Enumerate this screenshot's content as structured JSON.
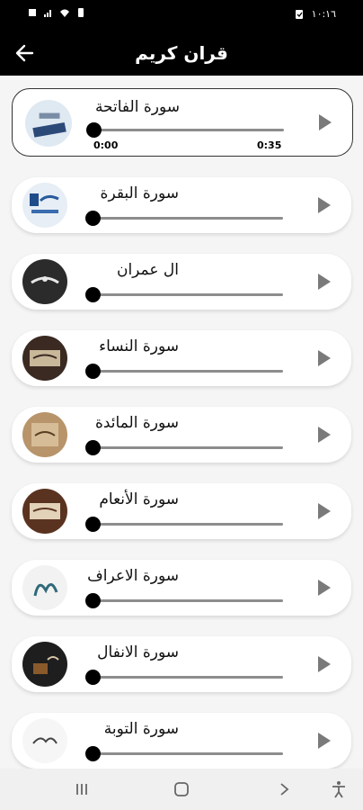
{
  "status_bar": {
    "time": "١٠:١٦"
  },
  "app_bar": {
    "title": "قران كريم"
  },
  "player": {
    "current_time": "0:00",
    "total_time": "0:35"
  },
  "surahs": [
    {
      "name": "سورة الفاتحة",
      "active": true,
      "progress": 0
    },
    {
      "name": "سورة البقرة",
      "progress": 0
    },
    {
      "name": "ال عمران",
      "progress": 0
    },
    {
      "name": "سورة النساء",
      "progress": 0
    },
    {
      "name": "سورة المائدة",
      "progress": 0
    },
    {
      "name": "سورة الأنعام",
      "progress": 0
    },
    {
      "name": "سورة الاعراف",
      "progress": 0
    },
    {
      "name": "سورة الانفال",
      "progress": 0
    },
    {
      "name": "سورة التوبة",
      "progress": 0
    }
  ],
  "colors": {
    "appbar": "#000000",
    "background": "#f5f5f5",
    "card": "#ffffff",
    "knob": "#000000",
    "track": "#8d8d8d"
  }
}
